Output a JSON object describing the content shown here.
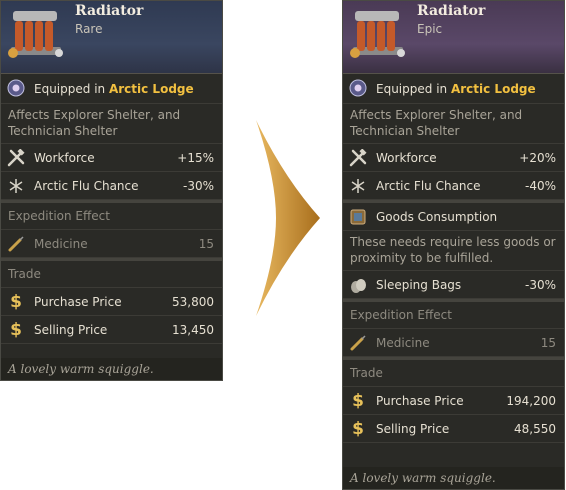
{
  "left": {
    "title": "Radiator",
    "rarity": "Rare",
    "equipped_prefix": "Equipped in",
    "equipped_location": "Arctic Lodge",
    "affects": "Affects Explorer Shelter, and Technician Shelter",
    "stats": [
      {
        "label": "Workforce",
        "value": "+15%",
        "icon": "hammer-wrench-icon"
      },
      {
        "label": "Arctic Flu Chance",
        "value": "-30%",
        "icon": "snowflake-icon"
      }
    ],
    "expedition_header": "Expedition Effect",
    "expedition": {
      "label": "Medicine",
      "value": "15",
      "icon": "syringe-icon"
    },
    "trade_header": "Trade",
    "trade": [
      {
        "label": "Purchase Price",
        "value": "53,800",
        "icon": "dollar-icon"
      },
      {
        "label": "Selling Price",
        "value": "13,450",
        "icon": "dollar-icon"
      }
    ],
    "flavor": "A lovely warm squiggle."
  },
  "right": {
    "title": "Radiator",
    "rarity": "Epic",
    "equipped_prefix": "Equipped in",
    "equipped_location": "Arctic Lodge",
    "affects": "Affects Explorer Shelter, and Technician Shelter",
    "stats": [
      {
        "label": "Workforce",
        "value": "+20%",
        "icon": "hammer-wrench-icon"
      },
      {
        "label": "Arctic Flu Chance",
        "value": "-40%",
        "icon": "snowflake-icon"
      }
    ],
    "goods_label": "Goods Consumption",
    "goods_desc": "These needs require less goods or proximity to be fulfilled.",
    "goods_stat": {
      "label": "Sleeping Bags",
      "value": "-30%",
      "icon": "sleeping-bags-icon"
    },
    "expedition_header": "Expedition Effect",
    "expedition": {
      "label": "Medicine",
      "value": "15",
      "icon": "syringe-icon"
    },
    "trade_header": "Trade",
    "trade": [
      {
        "label": "Purchase Price",
        "value": "194,200",
        "icon": "dollar-icon"
      },
      {
        "label": "Selling Price",
        "value": "48,550",
        "icon": "dollar-icon"
      }
    ],
    "flavor": "A lovely warm squiggle."
  },
  "colors": {
    "highlight": "#f2c040",
    "arrow": "#c58d2a",
    "card_bg": "#2a2a26"
  }
}
